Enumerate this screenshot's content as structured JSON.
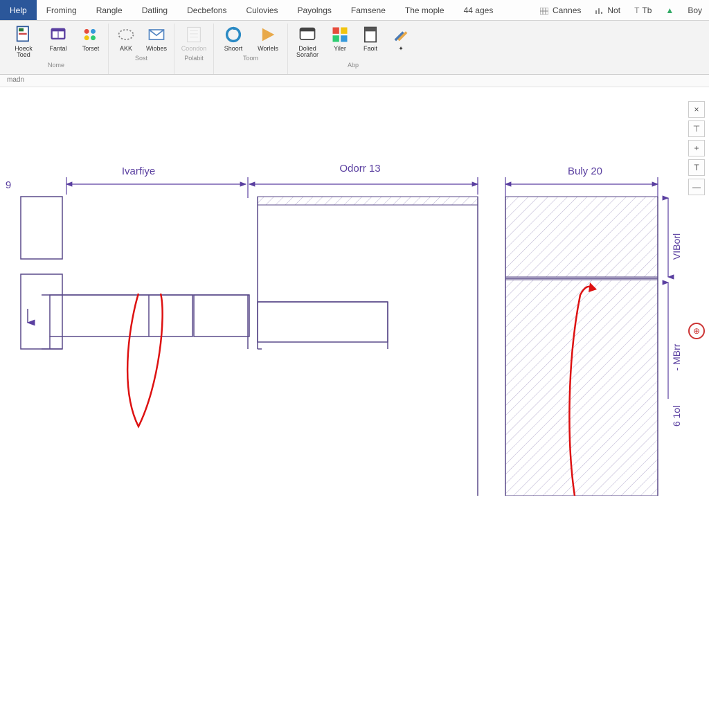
{
  "menubar": {
    "tabs": [
      "Help",
      "Froming",
      "Rangle",
      "Datling",
      "Decbefons",
      "Culovies",
      "Payolngs",
      "Famsene",
      "The mople",
      "44 ages"
    ],
    "right_items": [
      {
        "icon": "grid-icon",
        "label": "Cannes"
      },
      {
        "icon": "bars-icon",
        "label": "Not"
      },
      {
        "icon": "text-icon",
        "label": "Tb"
      },
      {
        "icon": "up-arrow-icon",
        "label": ""
      },
      {
        "icon": "",
        "label": "Boy"
      }
    ]
  },
  "ribbon": {
    "groups": [
      {
        "label": "Nome",
        "buttons": [
          {
            "id": "hoeck",
            "label": "Hoeck\nToed"
          },
          {
            "id": "fantal",
            "label": "Fantal"
          },
          {
            "id": "torset",
            "label": "Torset"
          }
        ]
      },
      {
        "label": "Sost",
        "buttons": [
          {
            "id": "akk",
            "label": "AKK"
          },
          {
            "id": "wiobes",
            "label": "Wiobes"
          }
        ]
      },
      {
        "label": "Polabit",
        "buttons": [
          {
            "id": "coondon",
            "label": "Coondon",
            "disabled": true
          }
        ]
      },
      {
        "label": "Toom",
        "buttons": [
          {
            "id": "shoort",
            "label": "Shoort"
          },
          {
            "id": "worlels",
            "label": "Worlels"
          }
        ]
      },
      {
        "label": "Abp",
        "buttons": [
          {
            "id": "dolied",
            "label": "Dolied\nSorañor"
          },
          {
            "id": "yiler",
            "label": "Yiler"
          },
          {
            "id": "faoit",
            "label": "Faoit"
          },
          {
            "id": "tools",
            "label": ""
          }
        ]
      }
    ]
  },
  "subbar": {
    "text": "madn"
  },
  "drawing": {
    "sections": [
      {
        "label": "Ivarfiye"
      },
      {
        "label": "Odorr 13"
      },
      {
        "label": "Buly 20"
      }
    ],
    "vlabels": [
      "VIBorl",
      "- MBrr",
      "6 1ol"
    ],
    "left_marker": "9"
  },
  "right_tools": {
    "items": [
      "×",
      "⊤",
      "+",
      "T",
      "—"
    ],
    "circle": "⊕"
  }
}
